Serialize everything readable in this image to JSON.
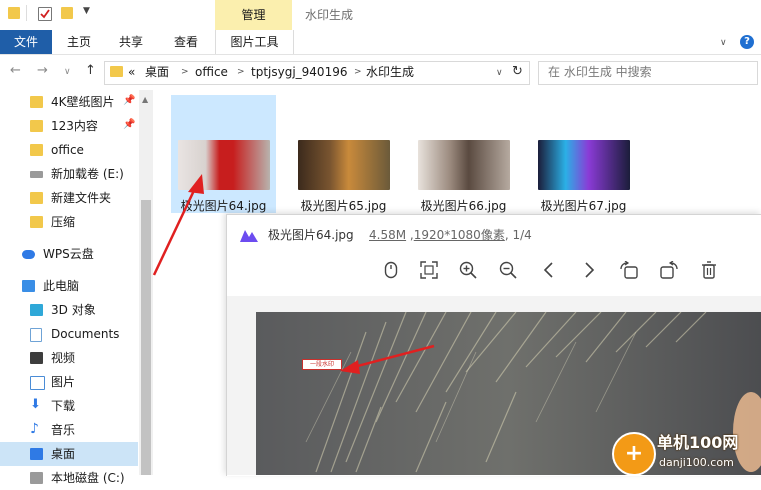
{
  "titlebar": {
    "context_tab": "管理",
    "title": "水印生成"
  },
  "tabs": {
    "file": "文件",
    "home": "主页",
    "share": "共享",
    "view": "查看",
    "picture_tools": "图片工具"
  },
  "help": "?",
  "address": {
    "overflow": "«",
    "crumbs": [
      "桌面",
      "office",
      "tptjsygj_940196",
      "水印生成"
    ],
    "search_placeholder": "在 水印生成 中搜索"
  },
  "sidebar": {
    "items": [
      {
        "label": "4K壁纸图片",
        "icon": "folder-icon",
        "color": "#f2c84b",
        "pinned": true
      },
      {
        "label": "123内容",
        "icon": "folder-icon",
        "color": "#f2c84b",
        "pinned": true
      },
      {
        "label": "office",
        "icon": "folder-icon",
        "color": "#f2c84b",
        "pinned": false
      },
      {
        "label": "新加载卷 (E:)",
        "icon": "drive-icon",
        "color": "#8a8a8a",
        "pinned": false
      },
      {
        "label": "新建文件夹",
        "icon": "folder-icon",
        "color": "#f2c84b",
        "pinned": false
      },
      {
        "label": "压缩",
        "icon": "folder-icon",
        "color": "#f2c84b",
        "pinned": false
      },
      {
        "label": "WPS云盘",
        "icon": "cloud-icon",
        "color": "#2f7ae5",
        "pinned": false
      },
      {
        "label": "此电脑",
        "icon": "pc-icon",
        "color": "#3a8ee6",
        "pinned": false
      },
      {
        "label": "3D 对象",
        "icon": "cube-icon",
        "color": "#2fa8d8",
        "pinned": false
      },
      {
        "label": "Documents",
        "icon": "document-icon",
        "color": "#6fa3d6",
        "pinned": false
      },
      {
        "label": "视频",
        "icon": "video-icon",
        "color": "#3d3d3d",
        "pinned": false
      },
      {
        "label": "图片",
        "icon": "picture-icon",
        "color": "#4a8cd6",
        "pinned": false
      },
      {
        "label": "下载",
        "icon": "download-icon",
        "color": "#2f7ae5",
        "pinned": false
      },
      {
        "label": "音乐",
        "icon": "music-icon",
        "color": "#2f7ae5",
        "pinned": false
      },
      {
        "label": "桌面",
        "icon": "desktop-icon",
        "color": "#2f7ae5",
        "pinned": false,
        "selected": true
      },
      {
        "label": "本地磁盘 (C:)",
        "icon": "drive-icon",
        "color": "#8a8a8a",
        "pinned": false
      }
    ]
  },
  "files": [
    {
      "name": "极光图片64.jpg",
      "selected": true,
      "thumb_colors": [
        "#e9e4e2",
        "#c71e1e",
        "#b8b3ae"
      ]
    },
    {
      "name": "极光图片65.jpg",
      "selected": false,
      "thumb_colors": [
        "#3b2a1c",
        "#c98a3b",
        "#6b5a3a"
      ]
    },
    {
      "name": "极光图片66.jpg",
      "selected": false,
      "thumb_colors": [
        "#e8e2dc",
        "#5a4a40",
        "#b6aaa0"
      ]
    },
    {
      "name": "极光图片67.jpg",
      "selected": false,
      "thumb_colors": [
        "#1b1d3a",
        "#8a3bd6",
        "#2bb0e6"
      ]
    }
  ],
  "viewer": {
    "filename": "极光图片64.jpg",
    "size": "4.58M",
    "resolution": "1920*1080像素",
    "counter": "1/4",
    "tools": [
      "mouse-icon",
      "fit-screen-icon",
      "zoom-in-icon",
      "zoom-out-icon",
      "previous-icon",
      "next-icon",
      "rotate-left-icon",
      "rotate-right-icon",
      "delete-icon"
    ],
    "watermark_text": "一段水印",
    "accent": "#6c4cf0"
  },
  "brand": {
    "name": "单机100网",
    "url": "danji100.com"
  }
}
